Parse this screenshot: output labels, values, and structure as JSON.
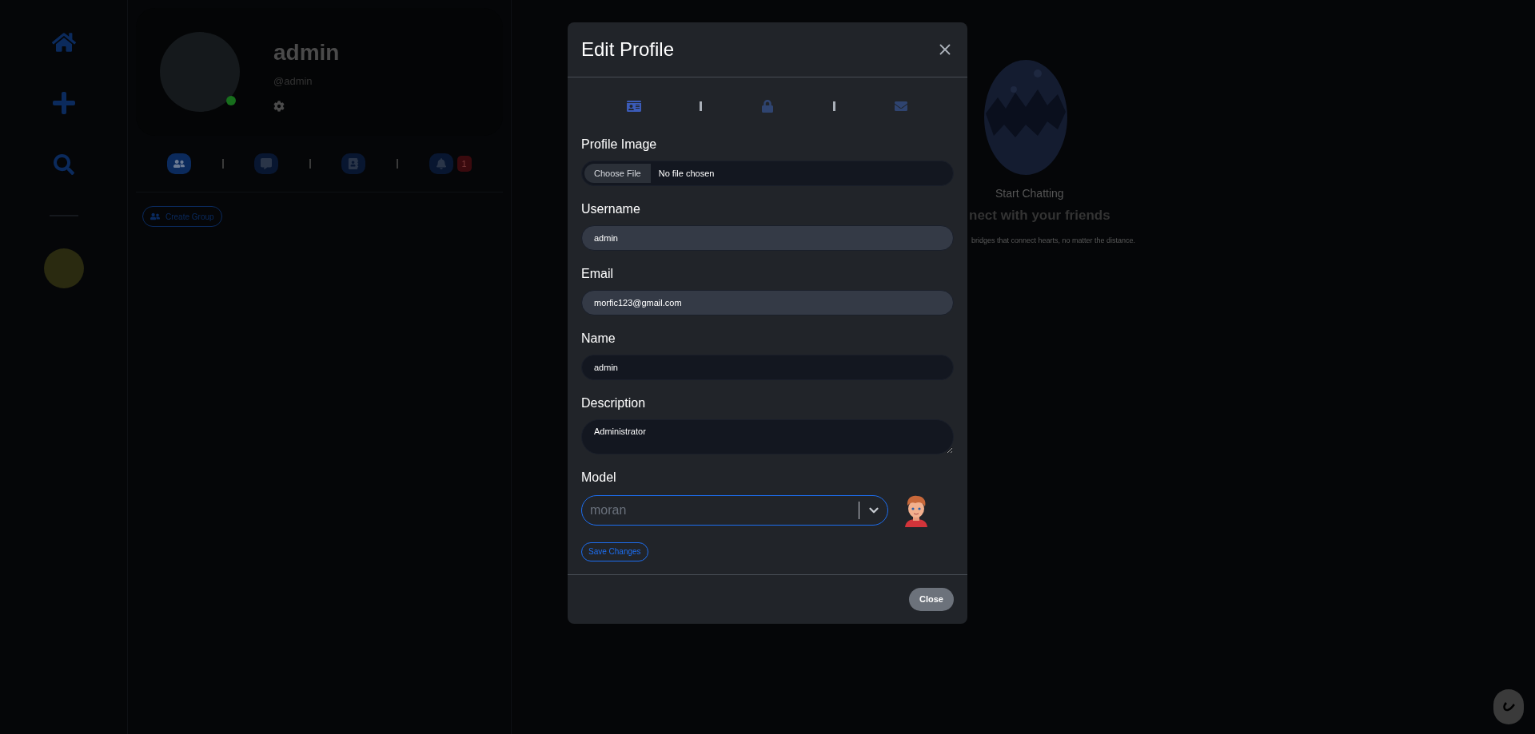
{
  "profile": {
    "name": "admin",
    "handle": "@admin",
    "online": true
  },
  "profile_tabs": [
    {
      "kind": "friends",
      "selected": true
    },
    {
      "kind": "chat",
      "selected": false
    },
    {
      "kind": "contacts",
      "selected": false
    },
    {
      "kind": "notifications",
      "selected": false,
      "badge": "1"
    }
  ],
  "create_group_button": "Create Group",
  "welcome": {
    "title": "Start Chatting",
    "heading": "nect with your friends",
    "text": "bridges that connect hearts, no matter the distance."
  },
  "modal": {
    "title": "Edit Profile",
    "tabs": [
      {
        "kind": "profile",
        "selected": true
      },
      {
        "kind": "password",
        "selected": false
      },
      {
        "kind": "email",
        "selected": false
      }
    ],
    "fields": [
      {
        "kind": "file",
        "label": "Profile Image",
        "button": "Choose File",
        "value": "No file chosen"
      },
      {
        "kind": "text",
        "label": "Username",
        "value": "admin",
        "disabled": true
      },
      {
        "kind": "text",
        "label": "Email",
        "value": "morfic123@gmail.com",
        "disabled": true
      },
      {
        "kind": "text",
        "label": "Name",
        "value": "admin",
        "disabled": false
      },
      {
        "kind": "textarea",
        "label": "Description",
        "value": "Administrator"
      },
      {
        "kind": "select",
        "label": "Model",
        "placeholder": "moran",
        "focused": true
      }
    ],
    "save_button": "Save Changes",
    "close_button": "Close"
  }
}
